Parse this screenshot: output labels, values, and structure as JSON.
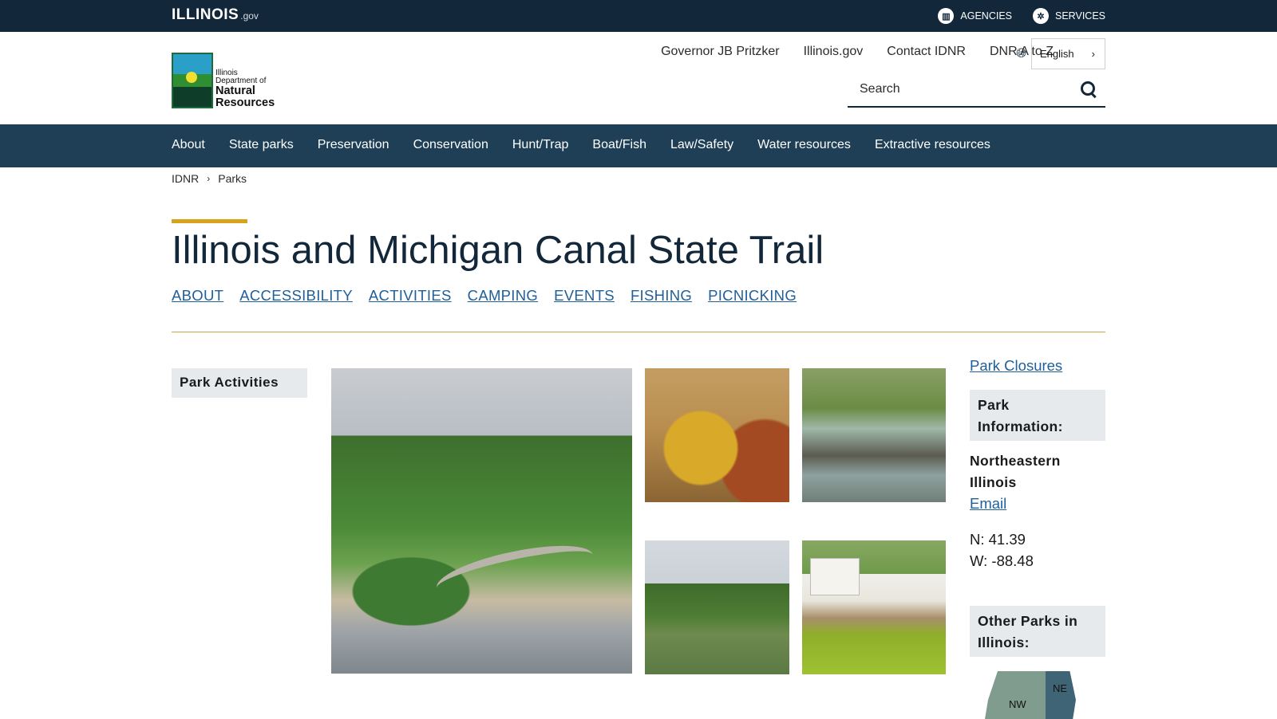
{
  "topbar": {
    "logo_word": "ILLINOIS",
    "logo_suffix": ".gov",
    "agencies_label": "AGENCIES",
    "services_label": "SERVICES"
  },
  "header": {
    "logo_line1": "Illinois",
    "logo_line2": "Department of",
    "logo_line3": "Natural",
    "logo_line4": "Resources",
    "util_links": [
      "Governor JB Pritzker",
      "Illinois.gov",
      "Contact IDNR",
      "DNR A to Z"
    ],
    "language": "English",
    "search_placeholder": "Search"
  },
  "mainnav": [
    "About",
    "State parks",
    "Preservation",
    "Conservation",
    "Hunt/Trap",
    "Boat/Fish",
    "Law/Safety",
    "Water resources",
    "Extractive resources"
  ],
  "breadcrumb": [
    "IDNR",
    "Parks"
  ],
  "page": {
    "title": "Illinois and Michigan Canal State Trail",
    "subnav": [
      "ABOUT",
      "ACCESSIBILITY",
      "ACTIVITIES",
      "CAMPING",
      "EVENTS",
      "FISHING",
      "PICNICKING"
    ]
  },
  "left_sidebar": {
    "park_activities": "Park Activities"
  },
  "right_sidebar": {
    "closures_link": "Park Closures",
    "park_info_heading": "Park Information:",
    "region": "Northeastern Illinois",
    "email_link": "Email",
    "lat": "N: 41.39",
    "lon": "W: -88.48",
    "other_parks_heading": "Other Parks in Illinois:",
    "map_labels": {
      "nw": "NW",
      "ne": "NE"
    }
  },
  "colors": {
    "topbar_bg": "#13273a",
    "nav_bg": "#1e3f55",
    "link": "#1f5f9a",
    "accent": "#d9a21b",
    "panel_bg": "#e6eaed"
  },
  "icons": {
    "agencies": "building-icon",
    "services": "gear-icon",
    "language": "globe-icon",
    "search": "search-icon",
    "breadcrumb_sep": "chevron-right-icon"
  }
}
